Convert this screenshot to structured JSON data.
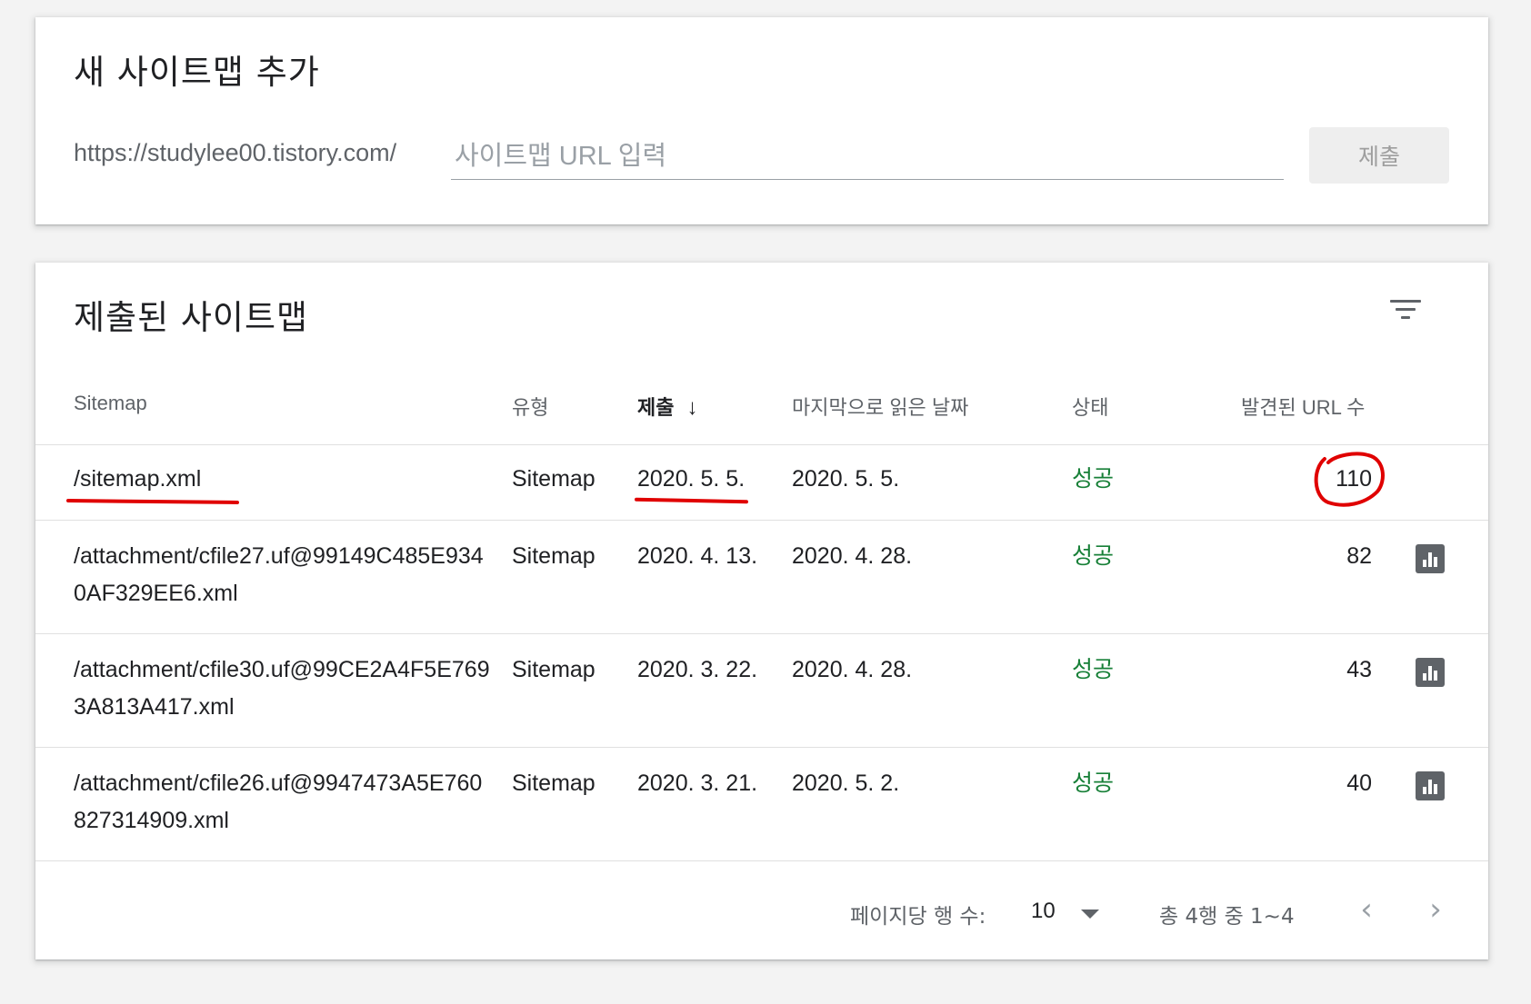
{
  "add_card": {
    "title": "새 사이트맵 추가",
    "url_prefix": "https://studylee00.tistory.com/",
    "input_placeholder": "사이트맵 URL 입력",
    "submit_label": "제출"
  },
  "list_card": {
    "title": "제출된 사이트맵",
    "columns": {
      "sitemap": "Sitemap",
      "type": "유형",
      "submitted": "제출",
      "last_read": "마지막으로 읽은 날짜",
      "status": "상태",
      "discovered_urls": "발견된 URL 수"
    },
    "sort_indicator": "↓",
    "rows": [
      {
        "sitemap": "/sitemap.xml",
        "type": "Sitemap",
        "submitted": "2020. 5. 5.",
        "last_read": "2020. 5. 5.",
        "status": "성공",
        "discovered_urls": "110"
      },
      {
        "sitemap": "/attachment/cfile27.uf@99149C485E9340AF329EE6.xml",
        "type": "Sitemap",
        "submitted": "2020. 4. 13.",
        "last_read": "2020. 4. 28.",
        "status": "성공",
        "discovered_urls": "82"
      },
      {
        "sitemap": "/attachment/cfile30.uf@99CE2A4F5E7693A813A417.xml",
        "type": "Sitemap",
        "submitted": "2020. 3. 22.",
        "last_read": "2020. 4. 28.",
        "status": "성공",
        "discovered_urls": "43"
      },
      {
        "sitemap": "/attachment/cfile26.uf@9947473A5E760827314909.xml",
        "type": "Sitemap",
        "submitted": "2020. 3. 21.",
        "last_read": "2020. 5. 2.",
        "status": "성공",
        "discovered_urls": "40"
      }
    ],
    "footer": {
      "rows_per_page_label": "페이지당 행 수:",
      "rows_per_page_value": "10",
      "range_label": "총 4행 중 1~4",
      "prev_icon": "chevron-left-icon",
      "next_icon": "chevron-right-icon"
    }
  },
  "colors": {
    "status_success": "#188038",
    "annotation_red": "#e00000"
  }
}
